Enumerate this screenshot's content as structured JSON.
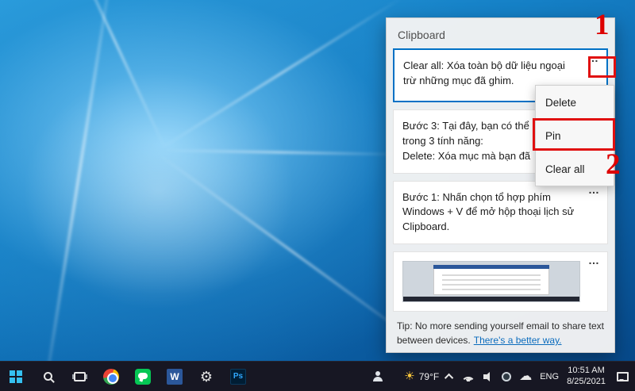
{
  "glyphs": {
    "ellipsis": "…",
    "gear": "⚙",
    "sun": "☀",
    "cloud": "☁"
  },
  "colors": {
    "selection_border": "#0071c5",
    "annotation_red": "#e01010",
    "link_blue": "#0b6cbd",
    "taskbar_bg": "#171723"
  },
  "annotations": {
    "step1": "1",
    "step2": "2"
  },
  "clipboard": {
    "title": "Clipboard",
    "item1_text": "Clear all: Xóa toàn bộ dữ liệu ngoại trừ những mục đã ghim.",
    "item2_line1": "Bước 3: Tại đây, bạn có thể",
    "item2_line2": "trong 3 tính năng:",
    "item2_line3": "Delete: Xóa mục mà bạn đã",
    "item3_text": "Bước 1: Nhấn chọn tổ hợp phím Windows + V để mở hộp thoại lịch sử Clipboard.",
    "menu": {
      "delete": "Delete",
      "pin": "Pin",
      "clear_all": "Clear all"
    },
    "tip_text": "Tip: No more sending yourself email to share text between devices.",
    "tip_link": "There's a better way."
  },
  "taskbar": {
    "weather": "79°F",
    "word_label": "W",
    "photoshop_label": "Ps",
    "language": "ENG",
    "time": "10:51 AM",
    "date": "8/25/2021"
  }
}
